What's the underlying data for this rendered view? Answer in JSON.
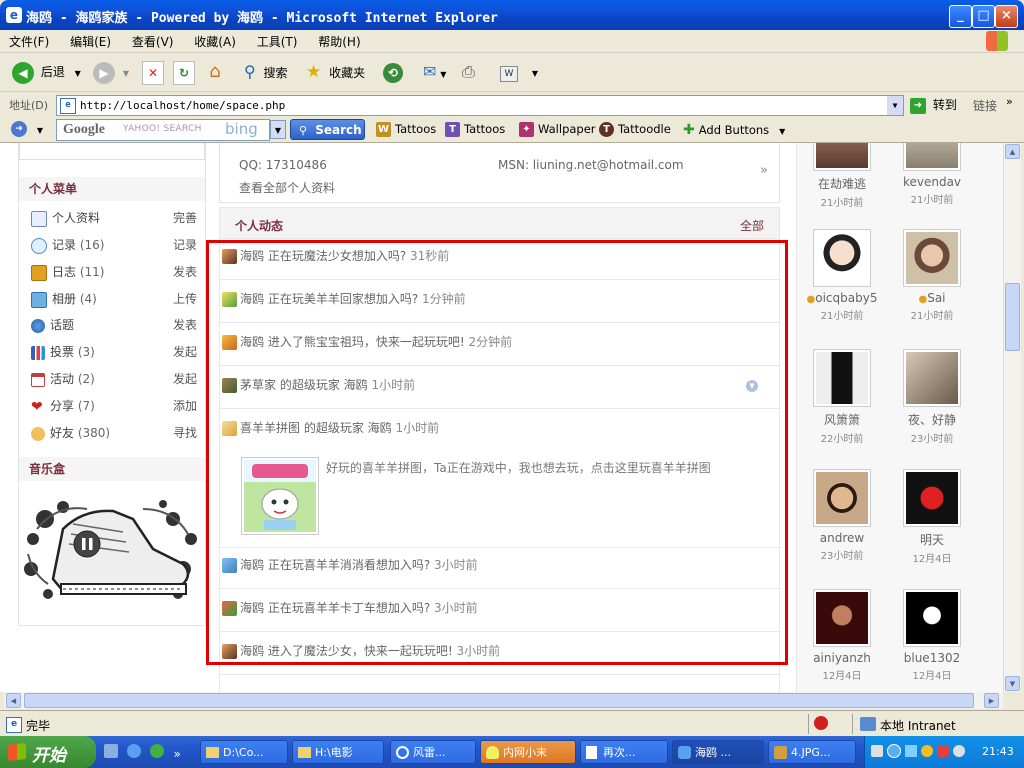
{
  "window": {
    "title": "海鸥 - 海鸥家族 - Powered by 海鸥 - Microsoft Internet Explorer"
  },
  "menu": [
    "文件(F)",
    "编辑(E)",
    "查看(V)",
    "收藏(A)",
    "工具(T)",
    "帮助(H)"
  ],
  "toolbar": {
    "back": "后退",
    "search": "搜索",
    "favorites": "收藏夹"
  },
  "address": {
    "label": "地址(D)",
    "url": "http://localhost/home/space.php",
    "go": "转到",
    "links": "链接"
  },
  "googlebar": {
    "google": "Google",
    "yahoo": "YAHOO! SEARCH",
    "bing": "bing",
    "search": "Search",
    "items": [
      "Tattoos",
      "Tattoos",
      "Wallpaper",
      "Tattoodle",
      "Add Buttons"
    ]
  },
  "profile": {
    "qq": "QQ: 17310486",
    "msn": "MSN: liuning.net@hotmail.com",
    "view_all": "查看全部个人资料",
    "more": "»"
  },
  "sidebar": {
    "menu_title": "个人菜单",
    "items": [
      {
        "label": "个人资料",
        "count": "",
        "action": "完善"
      },
      {
        "label": "记录",
        "count": "(16)",
        "action": "记录"
      },
      {
        "label": "日志",
        "count": "(11)",
        "action": "发表"
      },
      {
        "label": "相册",
        "count": "(4)",
        "action": "上传"
      },
      {
        "label": "话题",
        "count": "",
        "action": "发表"
      },
      {
        "label": "投票",
        "count": "(3)",
        "action": "发起"
      },
      {
        "label": "活动",
        "count": "(2)",
        "action": "发起"
      },
      {
        "label": "分享",
        "count": "(7)",
        "action": "添加"
      },
      {
        "label": "好友",
        "count": "(380)",
        "action": "寻找"
      }
    ],
    "music_title": "音乐盒"
  },
  "feed": {
    "title": "个人动态",
    "all": "全部",
    "items": [
      {
        "text": "海鸥 正在玩魔法少女想加入吗?",
        "time": "31秒前"
      },
      {
        "text": "海鸥 正在玩美羊羊回家想加入吗?",
        "time": "1分钟前"
      },
      {
        "text": "海鸥 进入了熊宝宝祖玛，快来一起玩玩吧!",
        "time": "2分钟前"
      },
      {
        "text": "茅草家 的超级玩家 海鸥",
        "time": "1小时前"
      },
      {
        "text": "喜羊羊拼图 的超级玩家 海鸥",
        "time": "1小时前"
      },
      {
        "text": "海鸥 正在玩喜羊羊消消看想加入吗?",
        "time": "3小时前"
      },
      {
        "text": "海鸥 正在玩喜羊羊卡丁车想加入吗?",
        "time": "3小时前"
      },
      {
        "text": "海鸥 进入了魔法少女，快来一起玩玩吧!",
        "time": "3小时前"
      }
    ],
    "game_desc": "好玩的喜羊羊拼图，Ta正在游戏中，我也想去玩，点击这里玩喜羊羊拼图"
  },
  "friends": [
    {
      "name": "在劫难逃",
      "time": "21小时前"
    },
    {
      "name": "kevendav",
      "time": "21小时前"
    },
    {
      "name": "oicqbaby5",
      "time": "21小时前"
    },
    {
      "name": "Sai",
      "time": "21小时前"
    },
    {
      "name": "风箫箫",
      "time": "22小时前"
    },
    {
      "name": "夜、好静",
      "time": "23小时前"
    },
    {
      "name": "andrew",
      "time": "23小时前"
    },
    {
      "name": "明天",
      "time": "12月4日"
    },
    {
      "name": "ainiyanzh",
      "time": "12月4日"
    },
    {
      "name": "blue1302",
      "time": "12月4日"
    }
  ],
  "status": {
    "text": "完毕",
    "zone": "本地 Intranet"
  },
  "taskbar": {
    "start": "开始",
    "tasks": [
      "D:\\Co...",
      "H:\\电影",
      "风雷...",
      "内网小末",
      "再次...",
      "海鸥 ...",
      "4.JPG..."
    ],
    "clock": "21:43"
  },
  "colors": {
    "accent": "#7a3040",
    "highlight": "#e00000",
    "titlebar": "#0a5ee8"
  }
}
